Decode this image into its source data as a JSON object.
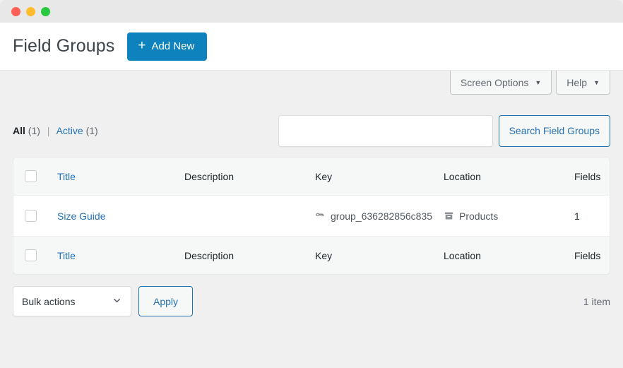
{
  "window": {
    "controls": [
      "close",
      "minimize",
      "maximize"
    ]
  },
  "header": {
    "title": "Field Groups",
    "add_new_label": "Add New",
    "add_new_icon": "plus-icon"
  },
  "meta_tabs": [
    {
      "label": "Screen Options",
      "icon": "caret-down-icon"
    },
    {
      "label": "Help",
      "icon": "caret-down-icon"
    }
  ],
  "filters": {
    "all_label": "All",
    "all_count": "(1)",
    "separator": "|",
    "active_label": "Active",
    "active_count": "(1)"
  },
  "search": {
    "value": "",
    "placeholder": "",
    "button_label": "Search Field Groups"
  },
  "table": {
    "columns": {
      "title": "Title",
      "description": "Description",
      "key": "Key",
      "location": "Location",
      "fields": "Fields"
    },
    "rows": [
      {
        "title": "Size Guide",
        "description": "",
        "key": "group_636282856c835",
        "key_icon": "key-icon",
        "location": "Products",
        "location_icon": "archive-box-icon",
        "fields": "1"
      }
    ]
  },
  "footer": {
    "bulk_actions_label": "Bulk actions",
    "bulk_actions_icon": "chevron-down-icon",
    "apply_label": "Apply",
    "item_count": "1 item"
  },
  "colors": {
    "accent": "#0d82bd",
    "link": "#2271b1",
    "page_bg": "#f0f0f1",
    "row_header_bg": "#f6f7f7"
  }
}
